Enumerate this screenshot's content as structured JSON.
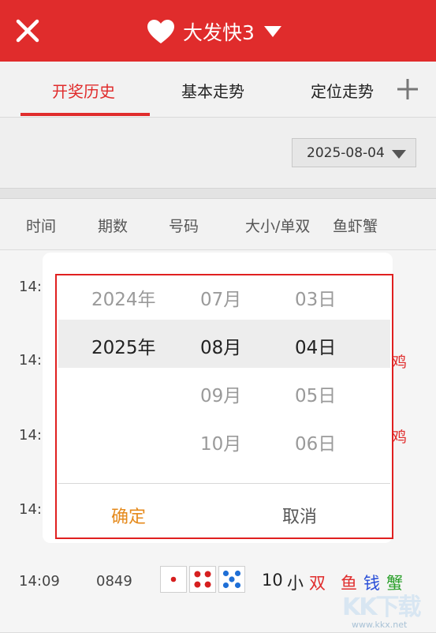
{
  "header": {
    "title": "大发快3"
  },
  "tabs": [
    {
      "label": "开奖历史"
    },
    {
      "label": "基本走势"
    },
    {
      "label": "定位走势"
    }
  ],
  "date_filter": {
    "value": "2025-08-04"
  },
  "columns": [
    "时间",
    "期数",
    "号码",
    "大小/单双",
    "鱼虾蟹"
  ],
  "rows": [
    {
      "time_partial": "14:"
    },
    {
      "time_partial": "14:",
      "trail": "鸡"
    },
    {
      "time_partial": "14:",
      "trail": "鸡"
    },
    {
      "time_partial": "14:"
    }
  ],
  "last_row": {
    "time": "14:09",
    "issue": "0849",
    "dice": [
      1,
      4,
      5
    ],
    "sum": "10",
    "size": "小",
    "parity": "双",
    "animals": [
      "鱼",
      "钱",
      "蟹"
    ]
  },
  "picker": {
    "years": [
      "2024年",
      "2025年"
    ],
    "months": [
      "07月",
      "08月",
      "09月",
      "10月"
    ],
    "days": [
      "03日",
      "04日",
      "05日",
      "06日"
    ],
    "confirm": "确定",
    "cancel": "取消"
  },
  "watermark": {
    "text": "KK下载",
    "url": "www.kkx.net"
  },
  "colors": {
    "accent": "#e02c2c",
    "confirm": "#e58a1c"
  }
}
